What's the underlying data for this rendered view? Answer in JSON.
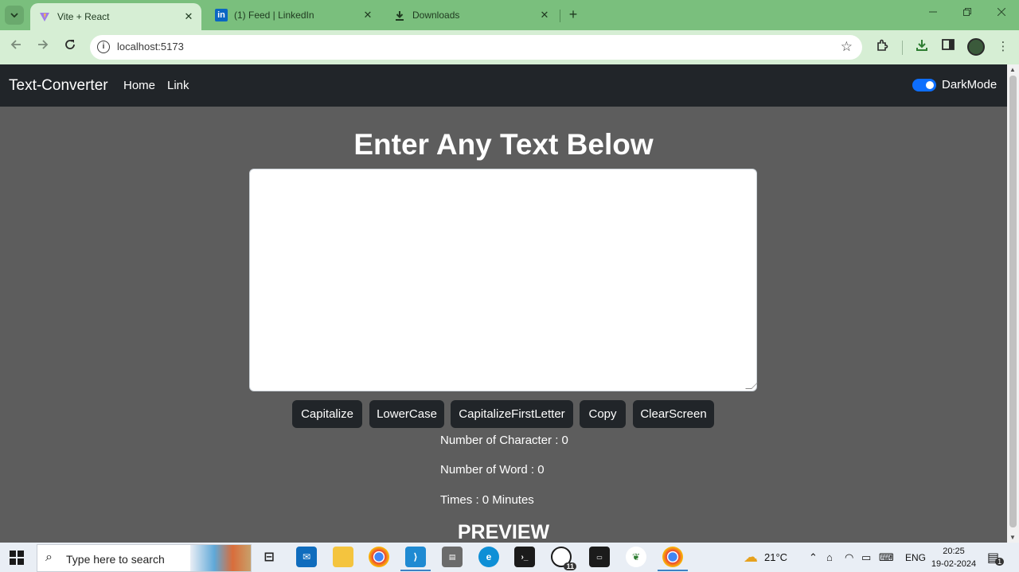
{
  "browser": {
    "tabs": [
      {
        "label": "Vite + React",
        "icon": "vite-icon",
        "active": true
      },
      {
        "label": "(1) Feed | LinkedIn",
        "icon": "linkedin-icon",
        "active": false
      },
      {
        "label": "Downloads",
        "icon": "download-icon",
        "active": false
      }
    ],
    "close_glyph": "✕",
    "new_tab_glyph": "+",
    "url": "localhost:5173"
  },
  "app": {
    "brand": "Text-Converter",
    "nav": {
      "home": "Home",
      "link": "Link"
    },
    "dark_mode_label": "DarkMode",
    "dark_mode_on": true,
    "heading": "Enter Any Text Below",
    "textarea_value": "",
    "buttons": {
      "capitalize": "Capitalize",
      "lowercase": "LowerCase",
      "capitalize_first": "CapitalizeFirstLetter",
      "copy": "Copy",
      "clear": "ClearScreen"
    },
    "stats": {
      "characters": "Number of Character : 0",
      "words": "Number of Word : 0",
      "time": "Times : 0 Minutes"
    },
    "preview_heading": "PREVIEW"
  },
  "taskbar": {
    "search_placeholder": "Type here to search",
    "whatsapp_badge": "11",
    "weather": "21°C",
    "language": "ENG",
    "time": "20:25",
    "date": "19-02-2024",
    "notification_count": "1"
  },
  "colors": {
    "tabstrip": "#7abf7d",
    "toolbar": "#d6eed4",
    "page_bg": "#5d5d5d",
    "navbar": "#212529",
    "button": "#212529",
    "toggle": "#0d6efd"
  }
}
